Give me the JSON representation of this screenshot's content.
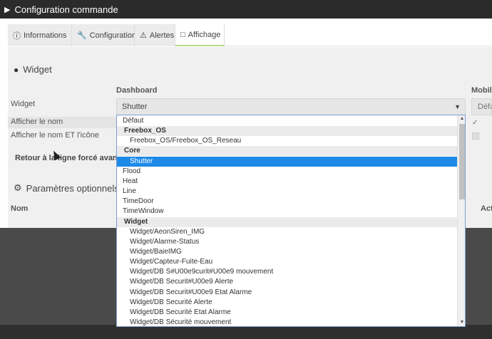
{
  "window": {
    "title": "Configuration commande"
  },
  "tabs": [
    {
      "label": "Informations",
      "icon": "info-circle-icon"
    },
    {
      "label": "Configuration",
      "icon": "wrench-icon"
    },
    {
      "label": "Alertes",
      "icon": "warning-icon"
    },
    {
      "label": "Affichage",
      "icon": "monitor-icon",
      "active": true
    }
  ],
  "widget_section": {
    "title": "Widget",
    "dashboard_header": "Dashboard",
    "mobile_header": "Mobile",
    "widget_label": "Widget",
    "dashboard_value": "Shutter",
    "mobile_value": "Défaut",
    "show_name_label": "Afficher le nom",
    "show_name_icon_label": "Afficher le nom ET l'icône",
    "forced_line_label": "Retour à la ligne forcé avant le"
  },
  "optional_section": {
    "title": "Paramètres optionnels",
    "name_header": "Nom",
    "action_header": "Act"
  },
  "dropdown": {
    "items": [
      {
        "type": "item",
        "label": "Défaut"
      },
      {
        "type": "group",
        "label": "Freebox_OS"
      },
      {
        "type": "item",
        "label": "Freebox_OS/Freebox_OS_Reseau",
        "indent": true
      },
      {
        "type": "group",
        "label": "Core"
      },
      {
        "type": "item",
        "label": "Shutter",
        "indent": true,
        "selected": true
      },
      {
        "type": "item",
        "label": "Flood"
      },
      {
        "type": "item",
        "label": "Heat"
      },
      {
        "type": "item",
        "label": "Line"
      },
      {
        "type": "item",
        "label": "TimeDoor"
      },
      {
        "type": "item",
        "label": "TimeWindow"
      },
      {
        "type": "group",
        "label": "Widget"
      },
      {
        "type": "item",
        "label": "Widget/AeonSiren_IMG",
        "indent": true
      },
      {
        "type": "item",
        "label": "Widget/Alarme-Status",
        "indent": true
      },
      {
        "type": "item",
        "label": "Widget/BaieIMG",
        "indent": true
      },
      {
        "type": "item",
        "label": "Widget/Capteur-Fuite-Eau",
        "indent": true
      },
      {
        "type": "item",
        "label": "Widget/DB S#U00e9curit#U00e9 mouvement",
        "indent": true
      },
      {
        "type": "item",
        "label": "Widget/DB Securit#U00e9 Alerte",
        "indent": true
      },
      {
        "type": "item",
        "label": "Widget/DB Securit#U00e9 Etat Alarme",
        "indent": true
      },
      {
        "type": "item",
        "label": "Widget/DB Securité Alerte",
        "indent": true
      },
      {
        "type": "item",
        "label": "Widget/DB Securité Etat Alarme",
        "indent": true
      },
      {
        "type": "item",
        "label": "Widget/DB Sécurité mouvement",
        "indent": true
      }
    ]
  },
  "colors": {
    "titlebar": "#2b2b2b",
    "selected": "#1e8ae8",
    "active_tab_underline": "#b8d98c"
  }
}
